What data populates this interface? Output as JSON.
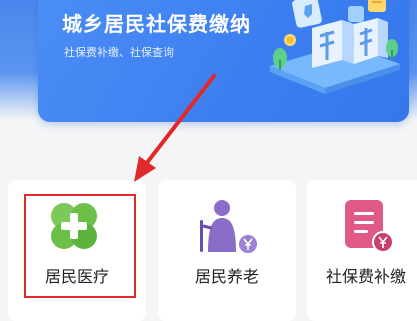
{
  "banner": {
    "title": "城乡居民社保费缴纳",
    "subtitle": "社保费补缴、社保查询"
  },
  "services": [
    {
      "label": "居民医疗",
      "icon": "medical-cross-icon",
      "color": "#6cc04a"
    },
    {
      "label": "居民养老",
      "icon": "elderly-person-icon",
      "color": "#8a6cc9"
    },
    {
      "label": "社保费补缴",
      "icon": "document-yen-icon",
      "color": "#e05a86"
    }
  ],
  "colors": {
    "banner": "#3d7ff0",
    "highlight": "#e02a2a"
  }
}
